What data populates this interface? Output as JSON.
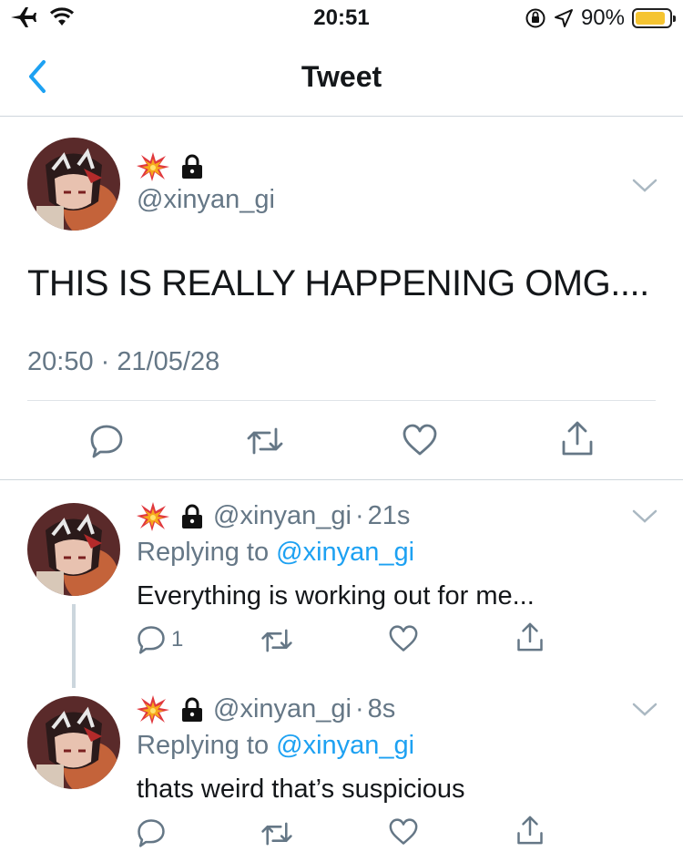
{
  "status_bar": {
    "time": "20:51",
    "battery_percent": "90%",
    "battery_level": 0.9,
    "icons": [
      "airplane-icon",
      "wifi-icon",
      "orientation-lock-icon",
      "location-icon",
      "battery-icon"
    ]
  },
  "nav": {
    "title": "Tweet",
    "back_icon": "chevron-left-icon"
  },
  "main_tweet": {
    "handle": "@xinyan_gi",
    "badges": [
      "collision-emoji-icon",
      "lock-icon"
    ],
    "text": "THIS IS REALLY HAPPENING OMG....",
    "timestamp": "20:50 · 21/05/28",
    "actions": [
      "reply-icon",
      "retweet-icon",
      "like-icon",
      "share-icon"
    ]
  },
  "replies": [
    {
      "handle": "@xinyan_gi",
      "time": "21s",
      "replying_prefix": "Replying to",
      "replying_to": "@xinyan_gi",
      "text": "Everything is working out for me...",
      "reply_count": "1"
    },
    {
      "handle": "@xinyan_gi",
      "time": "8s",
      "replying_prefix": "Replying to",
      "replying_to": "@xinyan_gi",
      "text": "thats weird that’s suspicious",
      "reply_count": ""
    }
  ],
  "colors": {
    "link": "#1da1f2",
    "secondary_text": "#657786",
    "divider": "#cfd6dc",
    "battery": "#f5c431"
  }
}
